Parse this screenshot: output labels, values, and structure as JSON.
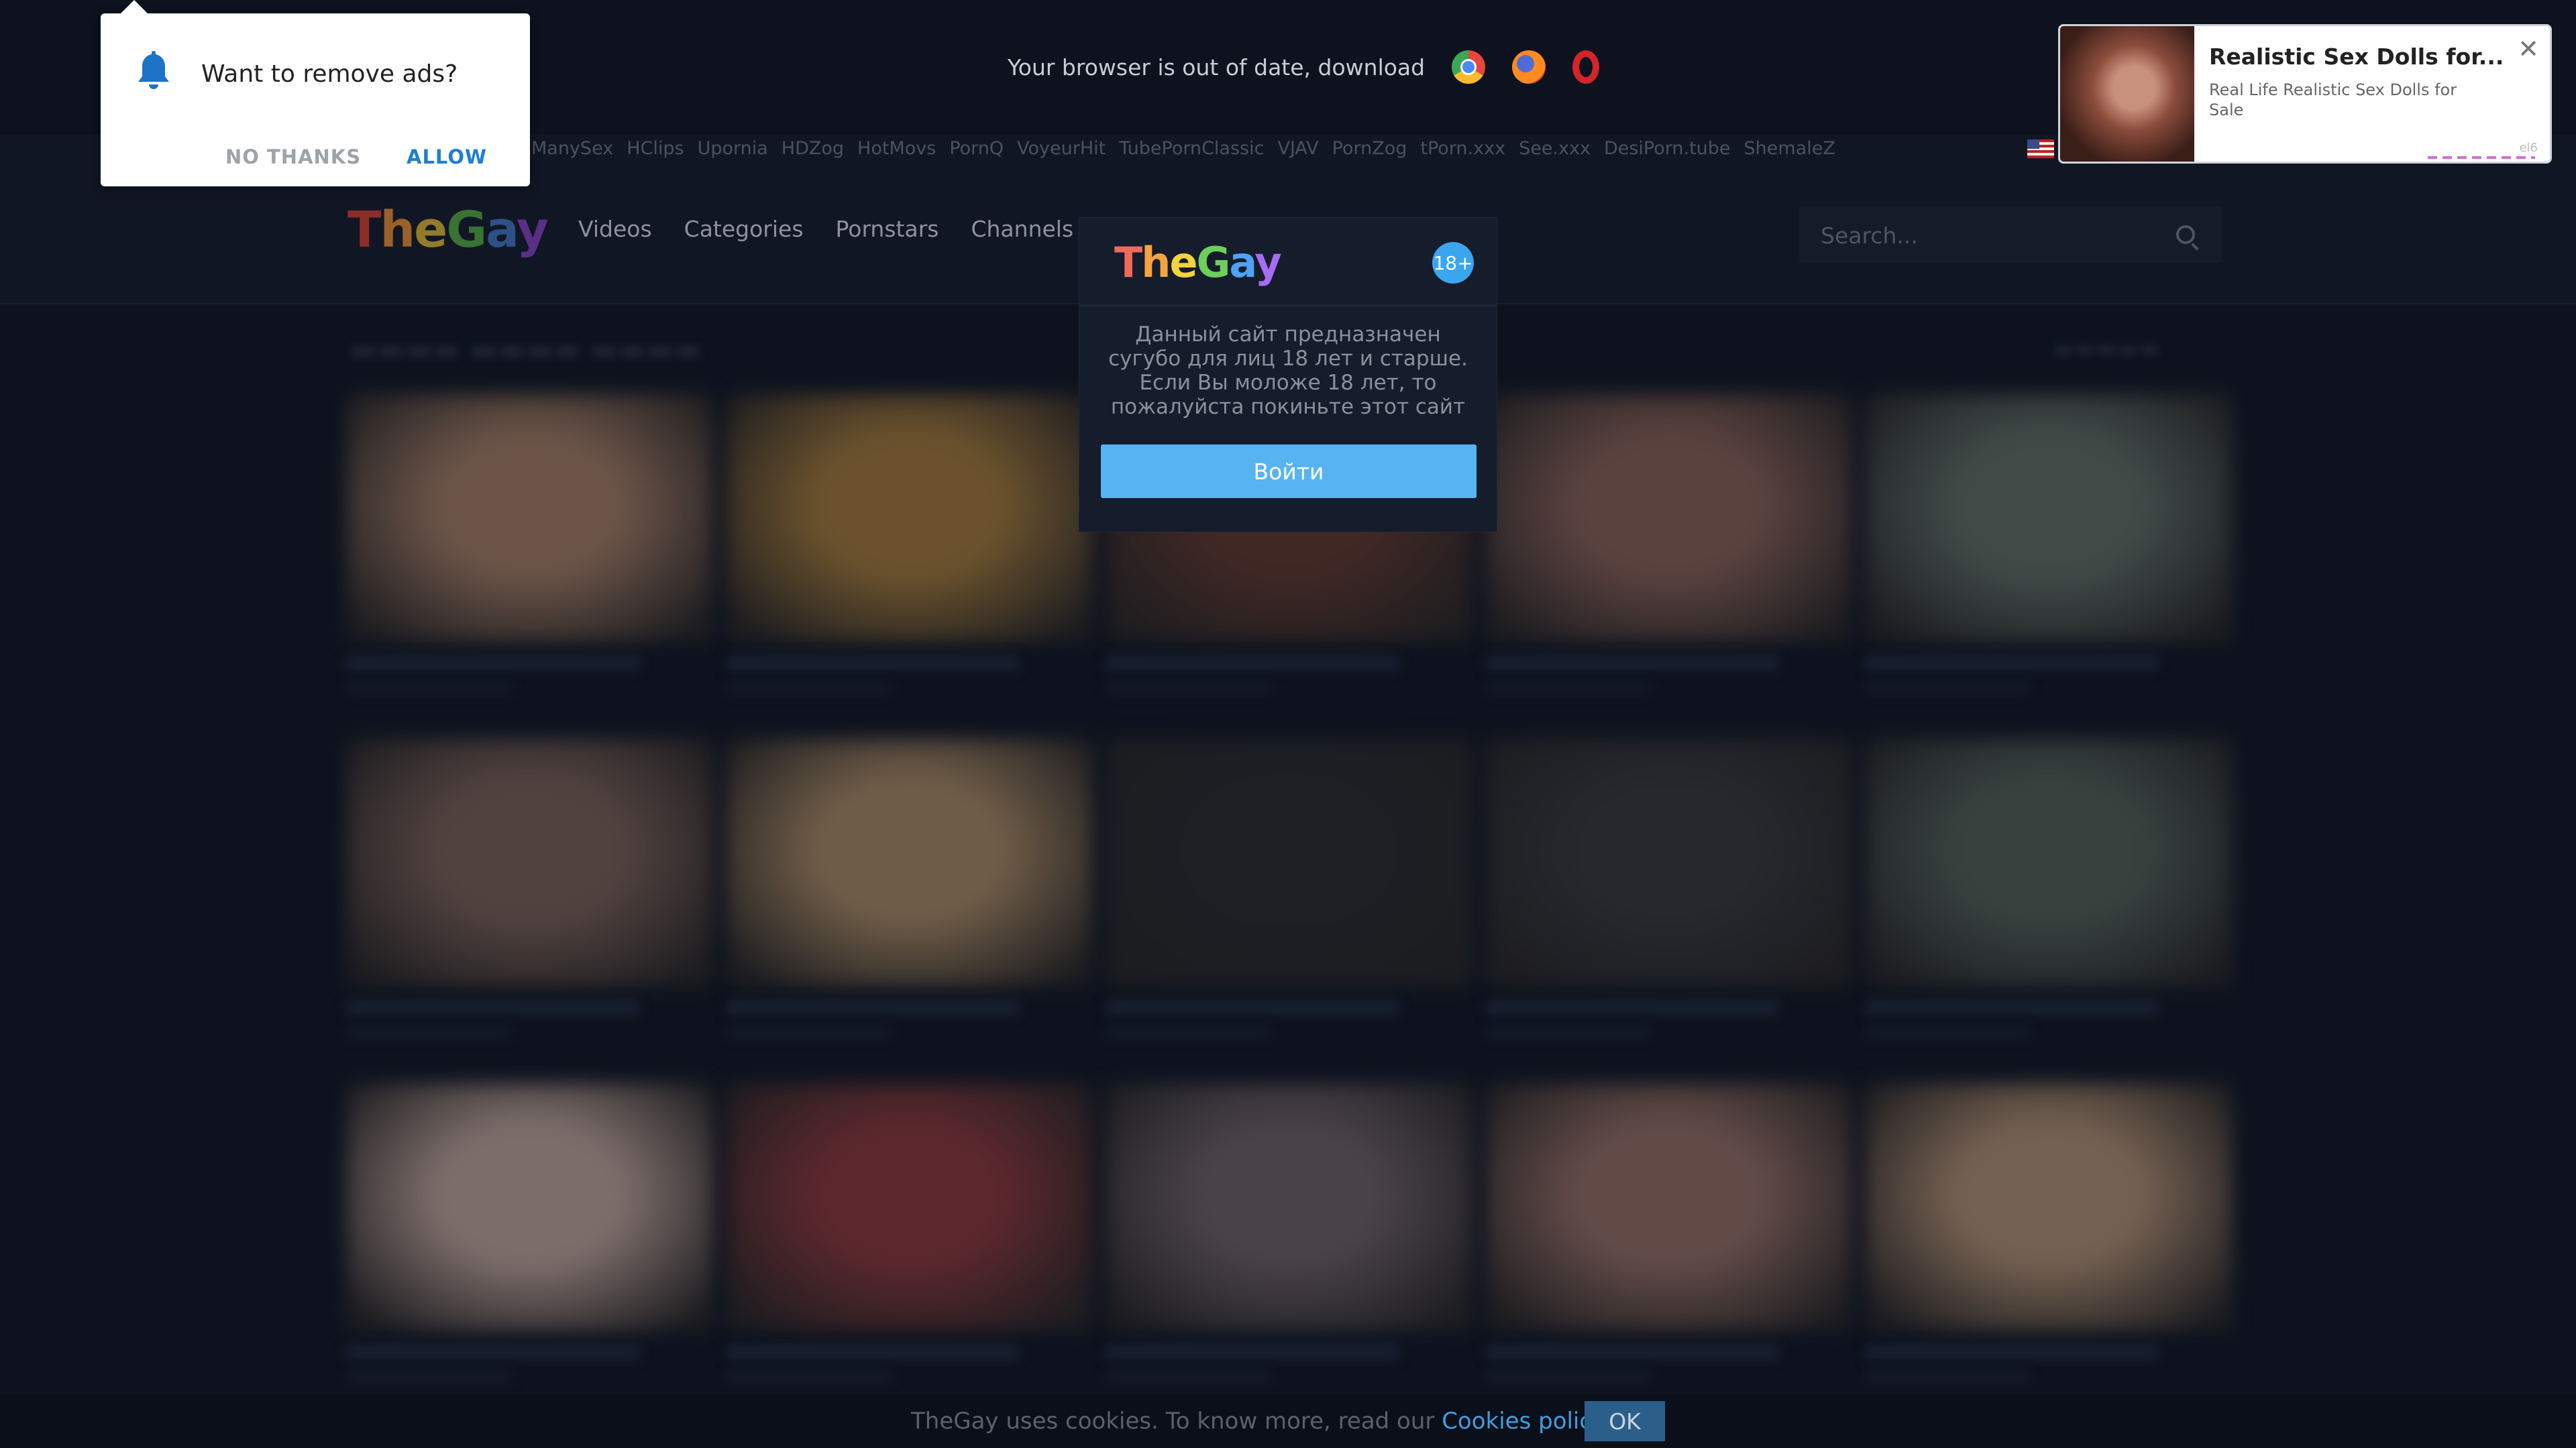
{
  "notice": {
    "text": "Your browser is out of date, download",
    "browsers": [
      "chrome-icon",
      "firefox-icon",
      "opera-icon"
    ]
  },
  "partners": [
    "ManySex",
    "HClips",
    "Upornia",
    "HDZog",
    "HotMovs",
    "PornQ",
    "VoyeurHit",
    "TubePornClassic",
    "VJAV",
    "PornZog",
    "tPorn.xxx",
    "See.xxx",
    "DesiPorn.tube",
    "ShemaleZ"
  ],
  "header": {
    "logo": "TheGay",
    "nav": [
      "Videos",
      "Categories",
      "Pornstars",
      "Channels"
    ],
    "search_placeholder": "Search..."
  },
  "age_modal": {
    "logo": "TheGay",
    "badge": "18+",
    "text": "Данный сайт предназначен сугубо для лиц 18 лет и старше. Если Вы моложе 18 лет, то пожалуйста покиньте этот сайт",
    "button": "Войти"
  },
  "push_prompt": {
    "question": "Want to remove ads?",
    "no_thanks": "NO THANKS",
    "allow": "ALLOW"
  },
  "ad": {
    "title": "Realistic Sex Dolls for...",
    "description": "Real Life Realistic Sex Dolls for Sale",
    "tag": "el6"
  },
  "cookie": {
    "text": "TheGay uses cookies. To know more, read our ",
    "link": "Cookies policy.",
    "ok": "OK"
  },
  "thumbnails": [
    {
      "color": "#b88a6a"
    },
    {
      "color": "#b8873a"
    },
    {
      "color": "#6a3a2a"
    },
    {
      "color": "#9a6a5a"
    },
    {
      "color": "#6a7a6a"
    },
    {
      "color": "#8a6a5a"
    },
    {
      "color": "#c09a6a"
    },
    {
      "color": "#2a2a2a"
    },
    {
      "color": "#3a3a3a"
    },
    {
      "color": "#5a6a5a"
    },
    {
      "color": "#d8b8a8"
    },
    {
      "color": "#9a3a3a"
    },
    {
      "color": "#7a6a6a"
    },
    {
      "color": "#a87a6a"
    },
    {
      "color": "#c8a07a"
    }
  ]
}
